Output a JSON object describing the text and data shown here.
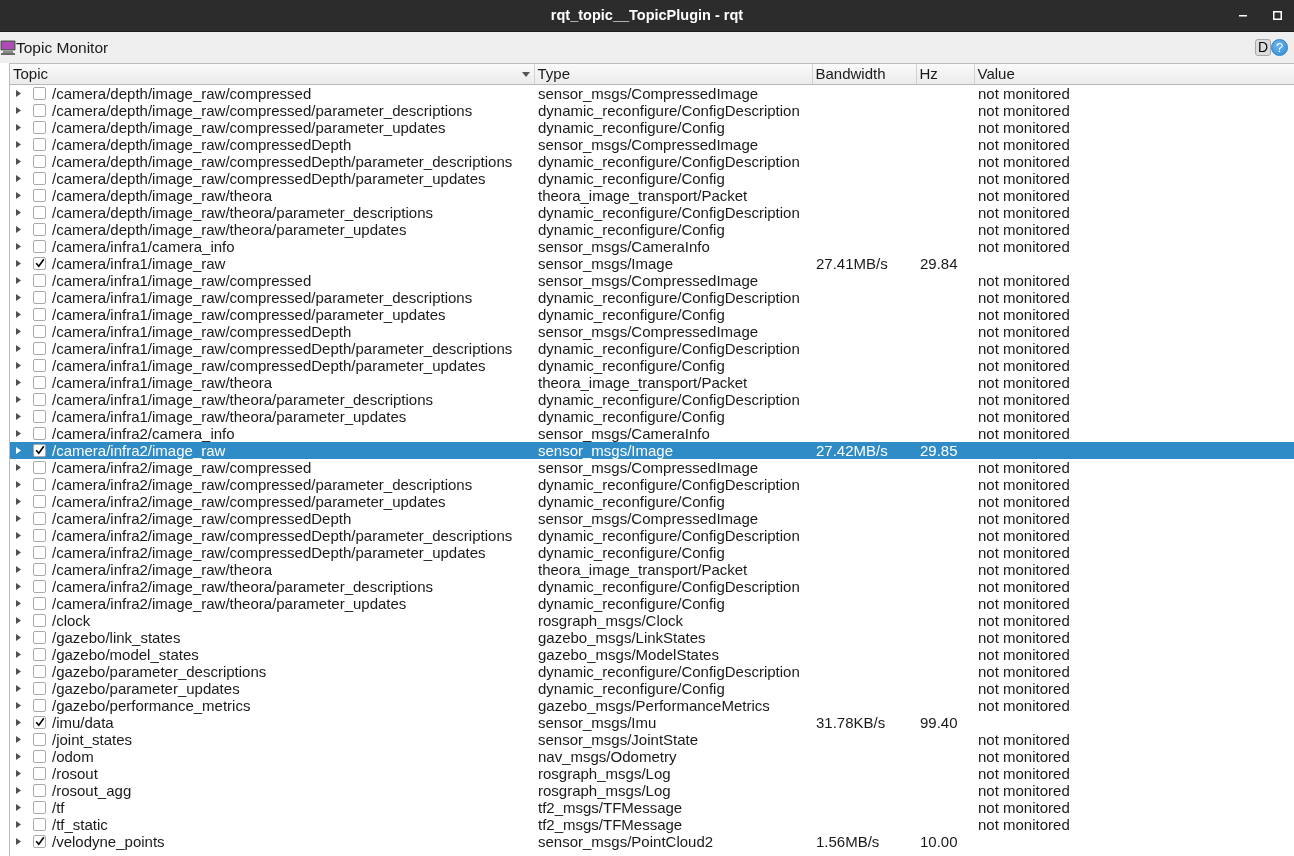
{
  "window": {
    "title": "rqt_topic__TopicPlugin - rqt"
  },
  "toolbar": {
    "title": "Topic Monitor",
    "buttons": [
      {
        "kind": "square",
        "label": "D"
      },
      {
        "kind": "round",
        "label": "?"
      }
    ]
  },
  "columns": [
    {
      "label": "Topic",
      "sorted": true
    },
    {
      "label": "Type",
      "sorted": false
    },
    {
      "label": "Bandwidth",
      "sorted": false
    },
    {
      "label": "Hz",
      "sorted": false
    },
    {
      "label": "Value",
      "sorted": false
    }
  ],
  "topics": [
    {
      "topic": "/camera/depth/image_raw/compressed",
      "type": "sensor_msgs/CompressedImage",
      "value": "not monitored",
      "checked": false,
      "selected": false,
      "expanded": false
    },
    {
      "topic": "/camera/depth/image_raw/compressed/parameter_descriptions",
      "type": "dynamic_reconfigure/ConfigDescription",
      "value": "not monitored",
      "checked": false,
      "selected": false,
      "expanded": false
    },
    {
      "topic": "/camera/depth/image_raw/compressed/parameter_updates",
      "type": "dynamic_reconfigure/Config",
      "value": "not monitored",
      "checked": false,
      "selected": false,
      "expanded": false
    },
    {
      "topic": "/camera/depth/image_raw/compressedDepth",
      "type": "sensor_msgs/CompressedImage",
      "value": "not monitored",
      "checked": false,
      "selected": false,
      "expanded": false
    },
    {
      "topic": "/camera/depth/image_raw/compressedDepth/parameter_descriptions",
      "type": "dynamic_reconfigure/ConfigDescription",
      "value": "not monitored",
      "checked": false,
      "selected": false,
      "expanded": false
    },
    {
      "topic": "/camera/depth/image_raw/compressedDepth/parameter_updates",
      "type": "dynamic_reconfigure/Config",
      "value": "not monitored",
      "checked": false,
      "selected": false,
      "expanded": false
    },
    {
      "topic": "/camera/depth/image_raw/theora",
      "type": "theora_image_transport/Packet",
      "value": "not monitored",
      "checked": false,
      "selected": false,
      "expanded": false
    },
    {
      "topic": "/camera/depth/image_raw/theora/parameter_descriptions",
      "type": "dynamic_reconfigure/ConfigDescription",
      "value": "not monitored",
      "checked": false,
      "selected": false,
      "expanded": false
    },
    {
      "topic": "/camera/depth/image_raw/theora/parameter_updates",
      "type": "dynamic_reconfigure/Config",
      "value": "not monitored",
      "checked": false,
      "selected": false,
      "expanded": false
    },
    {
      "topic": "/camera/infra1/camera_info",
      "type": "sensor_msgs/CameraInfo",
      "value": "not monitored",
      "checked": false,
      "selected": false,
      "expanded": false
    },
    {
      "topic": "/camera/infra1/image_raw",
      "type": "sensor_msgs/Image",
      "bandwidth": "27.41MB/s",
      "hz": "29.84",
      "checked": true,
      "selected": false,
      "expanded": false
    },
    {
      "topic": "/camera/infra1/image_raw/compressed",
      "type": "sensor_msgs/CompressedImage",
      "value": "not monitored",
      "checked": false,
      "selected": false,
      "expanded": false
    },
    {
      "topic": "/camera/infra1/image_raw/compressed/parameter_descriptions",
      "type": "dynamic_reconfigure/ConfigDescription",
      "value": "not monitored",
      "checked": false,
      "selected": false,
      "expanded": false
    },
    {
      "topic": "/camera/infra1/image_raw/compressed/parameter_updates",
      "type": "dynamic_reconfigure/Config",
      "value": "not monitored",
      "checked": false,
      "selected": false,
      "expanded": false
    },
    {
      "topic": "/camera/infra1/image_raw/compressedDepth",
      "type": "sensor_msgs/CompressedImage",
      "value": "not monitored",
      "checked": false,
      "selected": false,
      "expanded": false
    },
    {
      "topic": "/camera/infra1/image_raw/compressedDepth/parameter_descriptions",
      "type": "dynamic_reconfigure/ConfigDescription",
      "value": "not monitored",
      "checked": false,
      "selected": false,
      "expanded": false
    },
    {
      "topic": "/camera/infra1/image_raw/compressedDepth/parameter_updates",
      "type": "dynamic_reconfigure/Config",
      "value": "not monitored",
      "checked": false,
      "selected": false,
      "expanded": false
    },
    {
      "topic": "/camera/infra1/image_raw/theora",
      "type": "theora_image_transport/Packet",
      "value": "not monitored",
      "checked": false,
      "selected": false,
      "expanded": false
    },
    {
      "topic": "/camera/infra1/image_raw/theora/parameter_descriptions",
      "type": "dynamic_reconfigure/ConfigDescription",
      "value": "not monitored",
      "checked": false,
      "selected": false,
      "expanded": false
    },
    {
      "topic": "/camera/infra1/image_raw/theora/parameter_updates",
      "type": "dynamic_reconfigure/Config",
      "value": "not monitored",
      "checked": false,
      "selected": false,
      "expanded": false
    },
    {
      "topic": "/camera/infra2/camera_info",
      "type": "sensor_msgs/CameraInfo",
      "value": "not monitored",
      "checked": false,
      "selected": false,
      "expanded": false
    },
    {
      "topic": "/camera/infra2/image_raw",
      "type": "sensor_msgs/Image",
      "bandwidth": "27.42MB/s",
      "hz": "29.85",
      "checked": true,
      "selected": true,
      "expanded": false
    },
    {
      "topic": "/camera/infra2/image_raw/compressed",
      "type": "sensor_msgs/CompressedImage",
      "value": "not monitored",
      "checked": false,
      "selected": false,
      "expanded": false
    },
    {
      "topic": "/camera/infra2/image_raw/compressed/parameter_descriptions",
      "type": "dynamic_reconfigure/ConfigDescription",
      "value": "not monitored",
      "checked": false,
      "selected": false,
      "expanded": false
    },
    {
      "topic": "/camera/infra2/image_raw/compressed/parameter_updates",
      "type": "dynamic_reconfigure/Config",
      "value": "not monitored",
      "checked": false,
      "selected": false,
      "expanded": false
    },
    {
      "topic": "/camera/infra2/image_raw/compressedDepth",
      "type": "sensor_msgs/CompressedImage",
      "value": "not monitored",
      "checked": false,
      "selected": false,
      "expanded": false
    },
    {
      "topic": "/camera/infra2/image_raw/compressedDepth/parameter_descriptions",
      "type": "dynamic_reconfigure/ConfigDescription",
      "value": "not monitored",
      "checked": false,
      "selected": false,
      "expanded": false
    },
    {
      "topic": "/camera/infra2/image_raw/compressedDepth/parameter_updates",
      "type": "dynamic_reconfigure/Config",
      "value": "not monitored",
      "checked": false,
      "selected": false,
      "expanded": false
    },
    {
      "topic": "/camera/infra2/image_raw/theora",
      "type": "theora_image_transport/Packet",
      "value": "not monitored",
      "checked": false,
      "selected": false,
      "expanded": false
    },
    {
      "topic": "/camera/infra2/image_raw/theora/parameter_descriptions",
      "type": "dynamic_reconfigure/ConfigDescription",
      "value": "not monitored",
      "checked": false,
      "selected": false,
      "expanded": false
    },
    {
      "topic": "/camera/infra2/image_raw/theora/parameter_updates",
      "type": "dynamic_reconfigure/Config",
      "value": "not monitored",
      "checked": false,
      "selected": false,
      "expanded": false
    },
    {
      "topic": "/clock",
      "type": "rosgraph_msgs/Clock",
      "value": "not monitored",
      "checked": false,
      "selected": false,
      "expanded": false
    },
    {
      "topic": "/gazebo/link_states",
      "type": "gazebo_msgs/LinkStates",
      "value": "not monitored",
      "checked": false,
      "selected": false,
      "expanded": false
    },
    {
      "topic": "/gazebo/model_states",
      "type": "gazebo_msgs/ModelStates",
      "value": "not monitored",
      "checked": false,
      "selected": false,
      "expanded": false
    },
    {
      "topic": "/gazebo/parameter_descriptions",
      "type": "dynamic_reconfigure/ConfigDescription",
      "value": "not monitored",
      "checked": false,
      "selected": false,
      "expanded": false
    },
    {
      "topic": "/gazebo/parameter_updates",
      "type": "dynamic_reconfigure/Config",
      "value": "not monitored",
      "checked": false,
      "selected": false,
      "expanded": false
    },
    {
      "topic": "/gazebo/performance_metrics",
      "type": "gazebo_msgs/PerformanceMetrics",
      "value": "not monitored",
      "checked": false,
      "selected": false,
      "expanded": false
    },
    {
      "topic": "/imu/data",
      "type": "sensor_msgs/Imu",
      "bandwidth": "31.78KB/s",
      "hz": "99.40",
      "checked": true,
      "selected": false,
      "expanded": false
    },
    {
      "topic": "/joint_states",
      "type": "sensor_msgs/JointState",
      "value": "not monitored",
      "checked": false,
      "selected": false,
      "expanded": false
    },
    {
      "topic": "/odom",
      "type": "nav_msgs/Odometry",
      "value": "not monitored",
      "checked": false,
      "selected": false,
      "expanded": false
    },
    {
      "topic": "/rosout",
      "type": "rosgraph_msgs/Log",
      "value": "not monitored",
      "checked": false,
      "selected": false,
      "expanded": false
    },
    {
      "topic": "/rosout_agg",
      "type": "rosgraph_msgs/Log",
      "value": "not monitored",
      "checked": false,
      "selected": false,
      "expanded": false
    },
    {
      "topic": "/tf",
      "type": "tf2_msgs/TFMessage",
      "value": "not monitored",
      "checked": false,
      "selected": false,
      "expanded": false
    },
    {
      "topic": "/tf_static",
      "type": "tf2_msgs/TFMessage",
      "value": "not monitored",
      "checked": false,
      "selected": false,
      "expanded": false
    },
    {
      "topic": "/velodyne_points",
      "type": "sensor_msgs/PointCloud2",
      "bandwidth": "1.56MB/s",
      "hz": "10.00",
      "checked": true,
      "selected": false,
      "expanded": false
    }
  ]
}
